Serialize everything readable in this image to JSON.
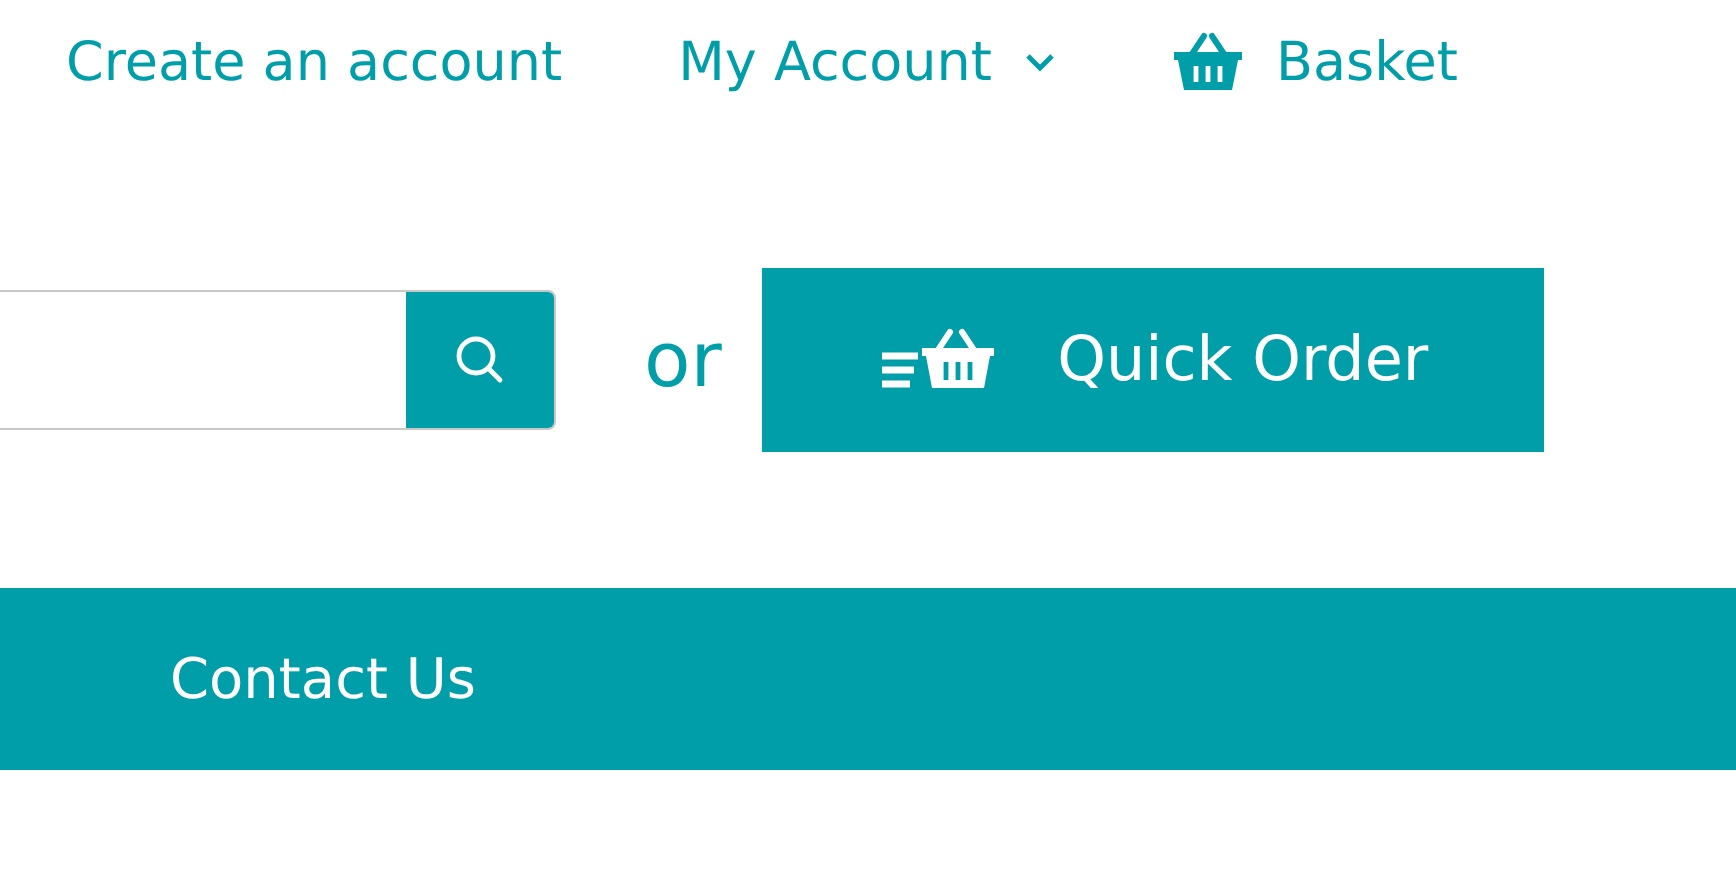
{
  "nav": [
    {
      "kind": "link",
      "label": "Create an account"
    },
    {
      "kind": "dropdown",
      "label": "My Account"
    },
    {
      "kind": "basket",
      "label": "Basket"
    }
  ],
  "separator": "or",
  "quick_order": {
    "label": "Quick Order"
  },
  "menu_bar": {
    "items": [
      "Contact Us"
    ]
  }
}
